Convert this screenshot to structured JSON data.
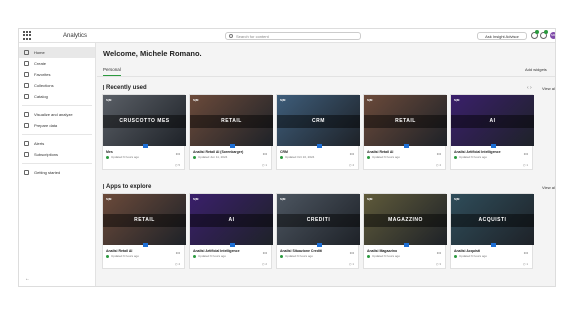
{
  "app": {
    "title": "Analytics"
  },
  "search": {
    "placeholder": "Search for content"
  },
  "header": {
    "ask_label": "Ask Insight Advisor",
    "avatar_initials": "MR"
  },
  "sidebar": {
    "items": [
      {
        "label": "Home",
        "icon": "home-icon"
      },
      {
        "label": "Create",
        "icon": "plus-icon"
      },
      {
        "label": "Favorites",
        "icon": "star-icon"
      },
      {
        "label": "Collections",
        "icon": "collection-icon"
      },
      {
        "label": "Catalog",
        "icon": "catalog-icon"
      },
      {
        "label": "Visualize and analyze",
        "icon": "chart-icon"
      },
      {
        "label": "Prepare data",
        "icon": "data-icon"
      },
      {
        "label": "Alerts",
        "icon": "bell-icon"
      },
      {
        "label": "Subscriptions",
        "icon": "mail-icon"
      },
      {
        "label": "Getting started",
        "icon": "rocket-icon"
      }
    ],
    "collapse_glyph": "←"
  },
  "main": {
    "welcome": "Welcome, Michele Romano.",
    "tab": "Personal",
    "add_widgets": "Add widgets",
    "view_all": "View all"
  },
  "sections": [
    {
      "title": "Recently used",
      "cards": [
        {
          "band": "CRUSCOTTO MES",
          "title": "Mes",
          "meta": "Updated 6 hours ago",
          "foot": "5",
          "theme": "#5a5f66"
        },
        {
          "band": "RETAIL",
          "title": "Analisi Retail AI (Sorenkarger)",
          "meta": "Updated Jun 11, 2024",
          "foot": "1",
          "theme": "#6b4a3a"
        },
        {
          "band": "CRM",
          "title": "CRM",
          "meta": "Updated Oct 10, 2024",
          "foot": "4",
          "theme": "#3e5d7a"
        },
        {
          "band": "RETAIL",
          "title": "Analisi Retail AI",
          "meta": "Updated 6 hours ago",
          "foot": "4",
          "theme": "#6b4a3a"
        },
        {
          "band": "AI",
          "title": "Analisi Artificial Intelligence",
          "meta": "Updated 6 hours ago",
          "foot": "1",
          "theme": "#3a1f6b"
        }
      ]
    },
    {
      "title": "Apps to explore",
      "cards": [
        {
          "band": "RETAIL",
          "title": "Analisi Retail AI",
          "meta": "Updated 6 hours ago",
          "foot": "4",
          "theme": "#6b4a3a"
        },
        {
          "band": "AI",
          "title": "Analisi Artificial Intelligence",
          "meta": "Updated 6 hours ago",
          "foot": "2",
          "theme": "#3a1f6b"
        },
        {
          "band": "CREDITI",
          "title": "Analisi Situazione Crediti",
          "meta": "Updated 6 hours ago",
          "foot": "1",
          "theme": "#4c5560"
        },
        {
          "band": "MAGAZZINO",
          "title": "Analisi Magazzino",
          "meta": "Updated 6 hours ago",
          "foot": "3",
          "theme": "#5f5a3a"
        },
        {
          "band": "ACQUISTI",
          "title": "Analisi Acquisti",
          "meta": "Updated 6 hours ago",
          "foot": "1",
          "theme": "#2f4d5a"
        }
      ]
    }
  ]
}
